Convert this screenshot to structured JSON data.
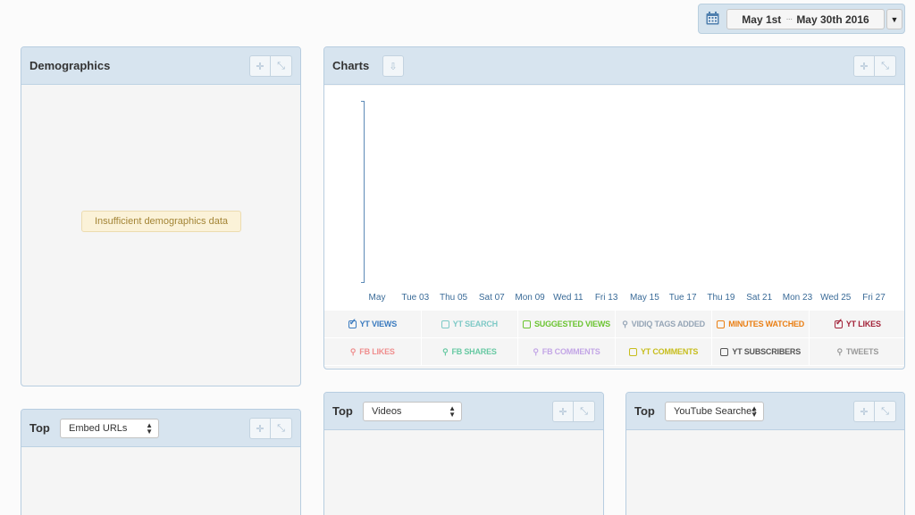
{
  "date_range": {
    "start": "May 1st",
    "separator": "···",
    "end": "May 30th 2016"
  },
  "demographics": {
    "title": "Demographics",
    "message": "Insufficient demographics data"
  },
  "charts": {
    "title": "Charts",
    "x_labels": [
      "May",
      "Tue 03",
      "Thu 05",
      "Sat 07",
      "Mon 09",
      "Wed 11",
      "Fri 13",
      "May 15",
      "Tue 17",
      "Thu 19",
      "Sat 21",
      "Mon 23",
      "Wed 25",
      "Fri 27"
    ],
    "legend_row1": [
      {
        "label": "YT VIEWS",
        "color": "#3b7bbf",
        "kind": "checked"
      },
      {
        "label": "YT SEARCH",
        "color": "#7ec9c6",
        "kind": "box"
      },
      {
        "label": "SUGGESTED VIEWS",
        "color": "#6bc431",
        "kind": "box"
      },
      {
        "label": "VIDIQ TAGS ADDED",
        "color": "#95a5b6",
        "kind": "key"
      },
      {
        "label": "MINUTES WATCHED",
        "color": "#ea7f14",
        "kind": "box"
      },
      {
        "label": "YT LIKES",
        "color": "#a3243a",
        "kind": "checked"
      }
    ],
    "legend_row2": [
      {
        "label": "FB LIKES",
        "color": "#ef8e8e",
        "kind": "key"
      },
      {
        "label": "FB SHARES",
        "color": "#68c9a3",
        "kind": "key"
      },
      {
        "label": "FB COMMENTS",
        "color": "#c3a6e6",
        "kind": "key"
      },
      {
        "label": "YT COMMENTS",
        "color": "#c7bd1c",
        "kind": "box"
      },
      {
        "label": "YT SUBSCRIBERS",
        "color": "#555555",
        "kind": "box"
      },
      {
        "label": "TWEETS",
        "color": "#9a9a9a",
        "kind": "key"
      }
    ]
  },
  "top_embed": {
    "title": "Top",
    "select_value": "Embed URLs"
  },
  "top_videos": {
    "title": "Top",
    "select_value": "Videos"
  },
  "top_searches": {
    "title": "Top",
    "select_value": "YouTube Searches"
  },
  "icons": {
    "move": "move-icon",
    "collapse": "collapse-icon",
    "download": "download-icon",
    "calendar": "calendar-icon"
  }
}
